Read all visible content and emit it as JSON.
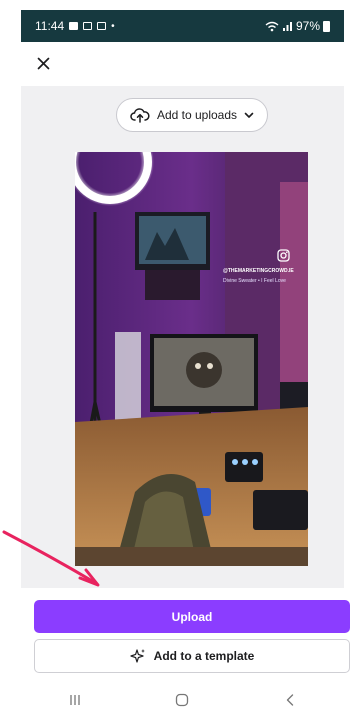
{
  "status_bar": {
    "time": "11:44",
    "battery": "97%",
    "background": "#16393f"
  },
  "header": {
    "close_icon": "close-icon"
  },
  "uploads_dropdown": {
    "label": "Add to uploads",
    "icon": "cloud-upload-icon",
    "chevron": "chevron-down-icon"
  },
  "preview": {
    "handle": "@THEMARKETINGCROWD.IE",
    "song": "Divine Sweater • I Feel Love",
    "social_icon": "instagram-icon"
  },
  "actions": {
    "upload_label": "Upload",
    "template_label": "Add to a template",
    "template_icon": "sparkle-icon",
    "accent": "#8b3dff"
  },
  "annotation": {
    "arrow_color": "#e8235f"
  },
  "nav": {
    "recents": "recent-apps-icon",
    "home": "home-icon",
    "back": "back-icon"
  }
}
